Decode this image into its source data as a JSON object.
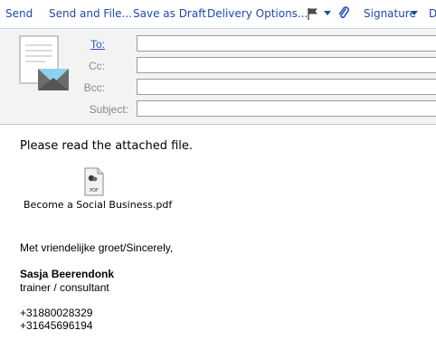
{
  "toolbar": {
    "send": "Send",
    "send_and_file": "Send and File...",
    "save_as_draft": "Save as Draft",
    "delivery_options": "Delivery Options...",
    "signature": "Signature",
    "more": "D"
  },
  "fields": {
    "to_label": "To:",
    "to_value": "",
    "cc_label": "Cc:",
    "cc_value": "",
    "bcc_label": "Bcc:",
    "bcc_value": "",
    "subject_label": "Subject:",
    "subject_value": ""
  },
  "body": {
    "line1": "Please read the attached file.",
    "attachment": {
      "name": "Become a Social Business.pdf",
      "icon_label": "PDF"
    },
    "signature": {
      "greeting": "Met vriendelijke groet/Sincerely,",
      "name": "Sasja Beerendonk",
      "role": "trainer / consultant",
      "phone1": "+31880028329",
      "phone2": "+31645696194"
    }
  },
  "colors": {
    "toolbar_text": "#1f4aa8",
    "header_bg": "#f3f3f3",
    "field_label": "#8a8a8a",
    "link_label": "#2a55c0"
  },
  "icons": [
    "flag-icon",
    "paperclip-icon",
    "envelope-letter-icon",
    "pdf-file-icon"
  ]
}
